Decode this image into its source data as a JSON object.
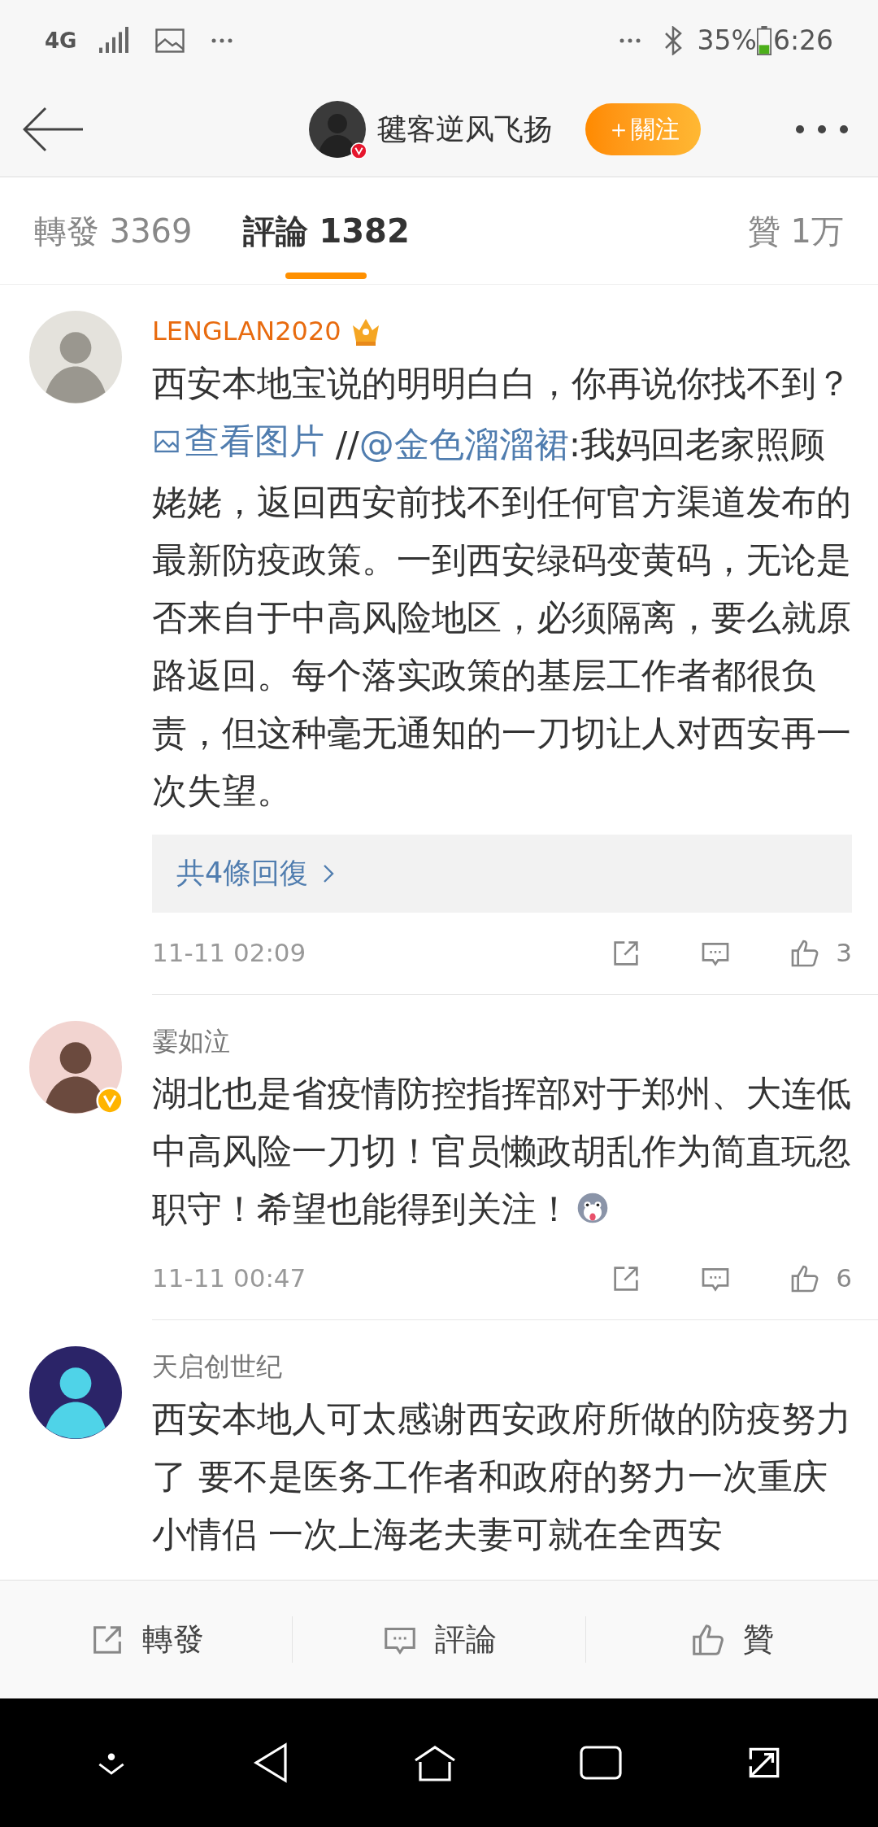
{
  "status_bar": {
    "network": "4G",
    "battery": "35%",
    "time": "6:26"
  },
  "header": {
    "username": "毽客逆风飞扬",
    "verified": true,
    "follow_button": "＋關注"
  },
  "tabs": [
    {
      "label": "轉發",
      "count": "3369",
      "selected": false
    },
    {
      "label": "評論",
      "count": "1382",
      "selected": true
    },
    {
      "label": "贊",
      "count": "1万",
      "selected": false
    }
  ],
  "comments": [
    {
      "username": "LENGLAN2020",
      "vip": true,
      "verified": false,
      "segments": [
        {
          "kind": "text",
          "text": "西安本地宝说的明明白白，你再说你找不到？ "
        },
        {
          "kind": "image_link",
          "text": "查看图片"
        },
        {
          "kind": "text",
          "text": " //"
        },
        {
          "kind": "mention",
          "text": "@金色溜溜裙"
        },
        {
          "kind": "text",
          "text": ":我妈回老家照顾姥姥，返回西安前找不到任何官方渠道发布的最新防疫政策。一到西安绿码变黄码，无论是否来自于中高风险地区，必须隔离，要么就原路返回。每个落实政策的基层工作者都很负责，但这种毫无通知的一刀切让人对西安再一次失望。"
        }
      ],
      "replies": "共4條回復",
      "time": "11-11 02:09",
      "likes": "3"
    },
    {
      "username": "霎如泣",
      "vip": false,
      "verified": true,
      "segments": [
        {
          "kind": "text",
          "text": "湖北也是省疫情防控指挥部对于郑州、大连低中高风险一刀切！官员懒政胡乱作为简直玩忽职守！希望也能得到关注！"
        },
        {
          "kind": "emoji"
        }
      ],
      "time": "11-11 00:47",
      "likes": "6"
    },
    {
      "username": "天启创世纪",
      "vip": false,
      "verified": false,
      "segments": [
        {
          "kind": "text",
          "text": "西安本地人可太感谢西安政府所做的防疫努力了 要不是医务工作者和政府的努力一次重庆小情侣 一次上海老夫妻可就在全西安"
        }
      ]
    }
  ],
  "bottom_bar": [
    {
      "kind": "repost",
      "label": "轉發"
    },
    {
      "kind": "comment",
      "label": "評論"
    },
    {
      "kind": "like",
      "label": "贊"
    }
  ]
}
